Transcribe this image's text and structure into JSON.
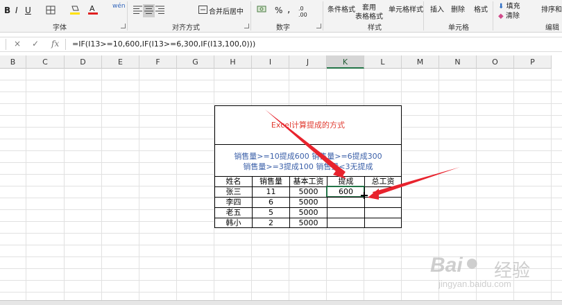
{
  "ribbon": {
    "font_group": "字体",
    "align_group": "对齐方式",
    "number_group": "数字",
    "styles_group": "样式",
    "cells_group": "单元格",
    "edit_group": "编辑",
    "bold": "B",
    "italic": "I",
    "underline": "U",
    "wen": "wén",
    "merge_center": "合并后居中",
    "percent": "%",
    "comma": ",",
    "cond_format": "条件格式",
    "table_format": "套用\n表格格式",
    "table_format_1": "套用",
    "table_format_2": "表格格式",
    "cell_style": "单元格样式",
    "insert": "插入",
    "delete": "删除",
    "format": "格式",
    "fill": "填充",
    "clear": "清除",
    "sort_filter": "排序和"
  },
  "formula_bar": {
    "cancel": "×",
    "confirm": "✓",
    "fx": "fx",
    "formula": "=IF(I13>=10,600,IF(I13>=6,300,IF(I13,100,0)))"
  },
  "columns": [
    "B",
    "C",
    "D",
    "E",
    "F",
    "G",
    "H",
    "I",
    "J",
    "K",
    "L",
    "M",
    "N",
    "O",
    "P"
  ],
  "selected_column": "K",
  "table": {
    "title": "Excel计算提成的方式",
    "rule_line1": "销售量>=10提成600  销售量>=6提成300",
    "rule_line2": "销售量>=3提成100  销售量<3无提成",
    "headers": [
      "姓名",
      "销售量",
      "基本工资",
      "提成",
      "总工资"
    ],
    "rows": [
      [
        "张三",
        "11",
        "5000",
        "600",
        ""
      ],
      [
        "李四",
        "6",
        "5000",
        "",
        ""
      ],
      [
        "老五",
        "5",
        "5000",
        "",
        ""
      ],
      [
        "韩小",
        "2",
        "5000",
        "",
        ""
      ]
    ]
  },
  "colors": {
    "title_red": "#e03a2f",
    "rule_blue": "#3a5fa8",
    "selection_green": "#217346",
    "arrow_red": "#e8232d"
  },
  "watermark": {
    "brand": "Bai",
    "brand_cn": "经验",
    "url": "jingyan.baidu.com"
  }
}
